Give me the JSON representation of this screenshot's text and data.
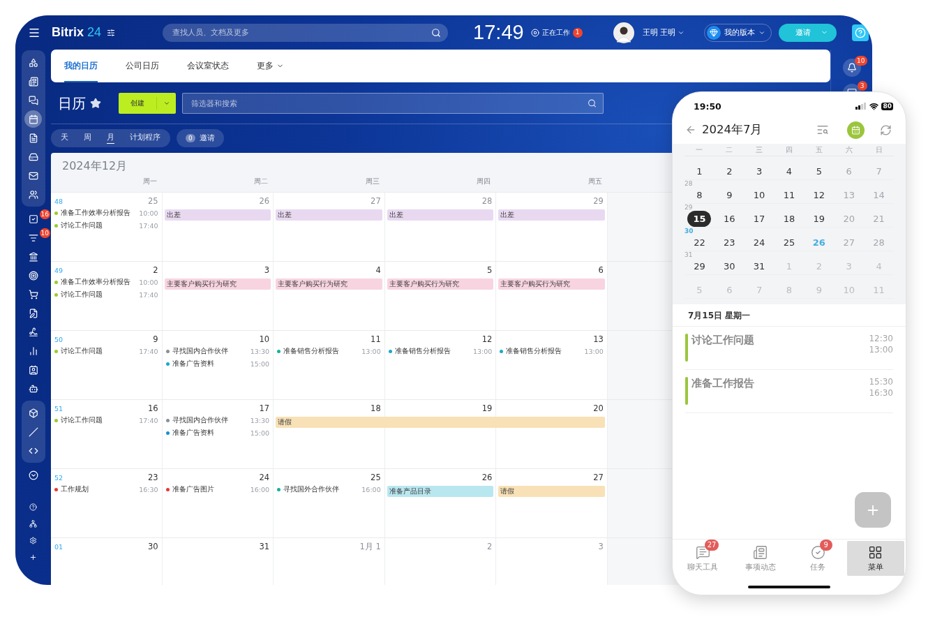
{
  "topbar": {
    "logo_name": "Bitrix",
    "logo_number": "24",
    "search": {
      "placeholder": "查找人员、文档及更多"
    },
    "clock": "17:49",
    "work_status": {
      "label": "正在工作",
      "badge": "1"
    },
    "user": {
      "name": "王明 王明"
    },
    "plan": {
      "label": "我的版本"
    },
    "invite_button": {
      "label": "邀请"
    }
  },
  "sidebar": {
    "sections": [
      {
        "kind": "group",
        "items": [
          {
            "selected": false
          },
          {
            "selected": false
          },
          {
            "selected": false
          },
          {
            "selected": true
          },
          {
            "selected": false
          },
          {
            "selected": false
          },
          {
            "selected": false
          },
          {
            "selected": false
          }
        ]
      },
      {
        "kind": "plain",
        "items": [
          {
            "selected": false,
            "badge": "16"
          },
          {
            "selected": false,
            "badge": "10"
          },
          {
            "selected": false
          },
          {
            "selected": false
          },
          {
            "selected": false
          },
          {
            "selected": false
          },
          {
            "selected": false
          },
          {
            "selected": false
          },
          {
            "selected": false
          },
          {
            "selected": false
          }
        ]
      },
      {
        "kind": "group",
        "items": [
          {
            "selected": false
          },
          {
            "selected": false
          },
          {
            "selected": false
          }
        ]
      },
      {
        "kind": "plain",
        "items": [
          {
            "selected": false
          }
        ]
      },
      {
        "kind": "tools",
        "items": [
          {
            "selected": false
          },
          {
            "selected": false
          },
          {
            "selected": false
          },
          {
            "selected": false
          }
        ]
      }
    ]
  },
  "right_rail": {
    "items": [
      {
        "kind": "help"
      },
      {
        "kind": "notify",
        "badge": "10"
      },
      {
        "kind": "notify",
        "badge": "3"
      }
    ]
  },
  "tabs": [
    {
      "label": "我的日历",
      "selected": true,
      "kind": "tab"
    },
    {
      "label": "公司日历",
      "selected": false,
      "kind": "tab"
    },
    {
      "label": "会议室状态",
      "selected": false,
      "kind": "tab"
    },
    {
      "label": "更多",
      "selected": false,
      "kind": "menu"
    }
  ],
  "toolbar": {
    "title": "日历",
    "create_button": "创建",
    "filter": {
      "placeholder": "筛选器和搜索"
    }
  },
  "views": [
    {
      "label": "天",
      "selected": false
    },
    {
      "label": "周",
      "selected": false
    },
    {
      "label": "月",
      "selected": true
    },
    {
      "label": "计划程序",
      "selected": false
    }
  ],
  "invitations": {
    "count": "0",
    "label": "邀请"
  },
  "calendar": {
    "month": "2024年12月",
    "weekdays": [
      "周一",
      "周二",
      "周三",
      "周四",
      "周五"
    ],
    "weeks": [
      {
        "week": "48",
        "days": [
          {
            "date": "25",
            "muted": true,
            "events": [
              {
                "kind": "dot",
                "title": "准备工作效率分析报告",
                "time": "10:00",
                "color": "#9ccc2c"
              },
              {
                "kind": "dot",
                "title": "讨论工作问题",
                "time": "17:40",
                "color": "#9ccc2c"
              }
            ]
          },
          {
            "date": "26",
            "muted": true,
            "events": [
              {
                "kind": "bar",
                "title": "出差",
                "color": "#e8d9f1"
              }
            ]
          },
          {
            "date": "27",
            "muted": true,
            "events": [
              {
                "kind": "bar",
                "title": "出差",
                "color": "#e8d9f1"
              }
            ]
          },
          {
            "date": "28",
            "muted": true,
            "events": [
              {
                "kind": "bar",
                "title": "出差",
                "color": "#e8d9f1"
              }
            ]
          },
          {
            "date": "29",
            "muted": true,
            "events": [
              {
                "kind": "bar",
                "title": "出差",
                "color": "#e8d9f1"
              }
            ]
          }
        ]
      },
      {
        "week": "49",
        "days": [
          {
            "date": "2",
            "muted": false,
            "events": [
              {
                "kind": "dot",
                "title": "准备工作效率分析报告",
                "time": "10:00",
                "color": "#9ccc2c"
              },
              {
                "kind": "dot",
                "title": "讨论工作问题",
                "time": "17:40",
                "color": "#9ccc2c"
              }
            ]
          },
          {
            "date": "3",
            "muted": false,
            "events": [
              {
                "kind": "bar",
                "title": "主要客户购买行为研究",
                "color": "#f8d4e0"
              }
            ]
          },
          {
            "date": "4",
            "muted": false,
            "events": [
              {
                "kind": "bar",
                "title": "主要客户购买行为研究",
                "color": "#f8d4e0"
              }
            ]
          },
          {
            "date": "5",
            "muted": false,
            "events": [
              {
                "kind": "bar",
                "title": "主要客户购买行为研究",
                "color": "#f8d4e0"
              }
            ]
          },
          {
            "date": "6",
            "muted": false,
            "events": [
              {
                "kind": "bar",
                "title": "主要客户购买行为研究",
                "color": "#f8d4e0"
              }
            ]
          }
        ]
      },
      {
        "week": "50",
        "days": [
          {
            "date": "9",
            "muted": false,
            "events": [
              {
                "kind": "dot",
                "title": "讨论工作问题",
                "time": "17:40",
                "color": "#9ccc2c"
              }
            ]
          },
          {
            "date": "10",
            "muted": false,
            "events": [
              {
                "kind": "dot",
                "title": "寻找国内合作伙伴",
                "time": "13:30",
                "color": "#8a8f98"
              },
              {
                "kind": "dot",
                "title": "准备广告资料",
                "time": "15:00",
                "color": "#1aa9c8"
              }
            ]
          },
          {
            "date": "11",
            "muted": false,
            "events": [
              {
                "kind": "dot",
                "title": "准备销售分析报告",
                "time": "13:00",
                "color": "#14b39c"
              }
            ]
          },
          {
            "date": "12",
            "muted": false,
            "events": [
              {
                "kind": "dot",
                "title": "准备销售分析报告",
                "time": "13:00",
                "color": "#1aa9c8"
              }
            ]
          },
          {
            "date": "13",
            "muted": false,
            "events": [
              {
                "kind": "dot",
                "title": "准备销售分析报告",
                "time": "13:00",
                "color": "#1aa9c8"
              }
            ]
          }
        ]
      },
      {
        "week": "51",
        "days": [
          {
            "date": "16",
            "muted": false,
            "events": [
              {
                "kind": "dot",
                "title": "讨论工作问题",
                "time": "17:40",
                "color": "#9ccc2c"
              }
            ]
          },
          {
            "date": "17",
            "muted": false,
            "events": [
              {
                "kind": "dot",
                "title": "寻找国内合作伙伴",
                "time": "13:30",
                "color": "#8a8f98"
              },
              {
                "kind": "dot",
                "title": "准备广告资料",
                "time": "15:00",
                "color": "#1a8fd0"
              }
            ]
          },
          {
            "date": "18",
            "muted": false,
            "events": [
              {
                "kind": "bar",
                "title": "请假",
                "color": "#f8e1b6"
              }
            ]
          },
          {
            "date": "19",
            "muted": false,
            "events": [
              {
                "kind": "continuation"
              }
            ]
          },
          {
            "date": "20",
            "muted": false,
            "events": [
              {
                "kind": "continuation"
              }
            ]
          }
        ]
      },
      {
        "week": "52",
        "days": [
          {
            "date": "23",
            "muted": false,
            "events": [
              {
                "kind": "dot",
                "title": "工作规划",
                "time": "16:30",
                "color": "#e53935"
              }
            ]
          },
          {
            "date": "24",
            "muted": false,
            "events": [
              {
                "kind": "dot",
                "title": "准备广告图片",
                "time": "16:00",
                "color": "#e53935"
              }
            ]
          },
          {
            "date": "25",
            "muted": false,
            "events": [
              {
                "kind": "dot",
                "title": "寻找国外合作伙伴",
                "time": "16:00",
                "color": "#14b39c"
              }
            ]
          },
          {
            "date": "26",
            "muted": false,
            "events": [
              {
                "kind": "bar",
                "title": "准备产品目录",
                "color": "#b9e7f0"
              }
            ]
          },
          {
            "date": "27",
            "muted": false,
            "events": [
              {
                "kind": "bar",
                "title": "请假",
                "color": "#f8e1b6"
              }
            ]
          }
        ]
      },
      {
        "week": "01",
        "days": [
          {
            "date": "30",
            "muted": false
          },
          {
            "date": "31",
            "muted": false
          },
          {
            "date": "1月 1",
            "muted": true
          },
          {
            "date": "2",
            "muted": true
          },
          {
            "date": "3",
            "muted": true
          }
        ]
      }
    ]
  },
  "phone": {
    "status_time": "19:50",
    "battery": "80",
    "title": "2024年7月",
    "weekdays": [
      "一",
      "二",
      "三",
      "四",
      "五",
      "六",
      "日"
    ],
    "weeks": [
      {
        "days": [
          {
            "label": "1",
            "kind": "weekday",
            "selected": false,
            "today": false
          },
          {
            "label": "2",
            "kind": "weekday",
            "selected": false,
            "today": false
          },
          {
            "label": "3",
            "kind": "weekday",
            "selected": false,
            "today": false
          },
          {
            "label": "4",
            "kind": "weekday",
            "selected": false,
            "today": false
          },
          {
            "label": "5",
            "kind": "weekday",
            "selected": false,
            "today": false
          },
          {
            "label": "6",
            "kind": "weekend",
            "selected": false,
            "today": false
          },
          {
            "label": "7",
            "kind": "weekend",
            "selected": false,
            "today": false
          }
        ]
      },
      {
        "week": "28",
        "current": false,
        "days": [
          {
            "label": "8",
            "kind": "weekday",
            "selected": false,
            "today": false
          },
          {
            "label": "9",
            "kind": "weekday",
            "selected": false,
            "today": false
          },
          {
            "label": "10",
            "kind": "weekday",
            "selected": false,
            "today": false
          },
          {
            "label": "11",
            "kind": "weekday",
            "selected": false,
            "today": false
          },
          {
            "label": "12",
            "kind": "weekday",
            "selected": false,
            "today": false
          },
          {
            "label": "13",
            "kind": "weekend",
            "selected": false,
            "today": false
          },
          {
            "label": "14",
            "kind": "weekend",
            "selected": false,
            "today": false
          }
        ]
      },
      {
        "week": "29",
        "current": false,
        "days": [
          {
            "label": "15",
            "kind": "weekday",
            "selected": true,
            "today": false
          },
          {
            "label": "16",
            "kind": "weekday",
            "selected": false,
            "today": false
          },
          {
            "label": "17",
            "kind": "weekday",
            "selected": false,
            "today": false
          },
          {
            "label": "18",
            "kind": "weekday",
            "selected": false,
            "today": false
          },
          {
            "label": "19",
            "kind": "weekday",
            "selected": false,
            "today": false
          },
          {
            "label": "20",
            "kind": "weekend",
            "selected": false,
            "today": false
          },
          {
            "label": "21",
            "kind": "weekend",
            "selected": false,
            "today": false
          }
        ]
      },
      {
        "week": "30",
        "current": true,
        "days": [
          {
            "label": "22",
            "kind": "weekday",
            "selected": false,
            "today": false
          },
          {
            "label": "23",
            "kind": "weekday",
            "selected": false,
            "today": false
          },
          {
            "label": "24",
            "kind": "weekday",
            "selected": false,
            "today": false
          },
          {
            "label": "25",
            "kind": "weekday",
            "selected": false,
            "today": false
          },
          {
            "label": "26",
            "kind": "weekday",
            "selected": false,
            "today": true
          },
          {
            "label": "27",
            "kind": "weekend",
            "selected": false,
            "today": false
          },
          {
            "label": "28",
            "kind": "weekend",
            "selected": false,
            "today": false
          }
        ]
      },
      {
        "week": "31",
        "current": false,
        "days": [
          {
            "label": "29",
            "kind": "weekday",
            "selected": false,
            "today": false
          },
          {
            "label": "30",
            "kind": "weekday",
            "selected": false,
            "today": false
          },
          {
            "label": "31",
            "kind": "weekday",
            "selected": false,
            "today": false
          },
          {
            "label": "1",
            "kind": "outside",
            "selected": false,
            "today": false
          },
          {
            "label": "2",
            "kind": "outside",
            "selected": false,
            "today": false
          },
          {
            "label": "3",
            "kind": "outside",
            "selected": false,
            "today": false
          },
          {
            "label": "4",
            "kind": "outside",
            "selected": false,
            "today": false
          }
        ]
      },
      {
        "days": [
          {
            "label": "5",
            "kind": "outside",
            "selected": false,
            "today": false
          },
          {
            "label": "6",
            "kind": "outside",
            "selected": false,
            "today": false
          },
          {
            "label": "7",
            "kind": "outside",
            "selected": false,
            "today": false
          },
          {
            "label": "8",
            "kind": "outside",
            "selected": false,
            "today": false
          },
          {
            "label": "9",
            "kind": "outside",
            "selected": false,
            "today": false
          },
          {
            "label": "10",
            "kind": "outside",
            "selected": false,
            "today": false
          },
          {
            "label": "11",
            "kind": "outside",
            "selected": false,
            "today": false
          }
        ]
      }
    ],
    "agenda_date": "7月15日 星期一",
    "events": [
      {
        "title": "讨论工作问题",
        "start": "12:30",
        "end": "13:00"
      },
      {
        "title": "准备工作报告",
        "start": "15:30",
        "end": "16:30"
      }
    ],
    "tabbar": [
      {
        "label": "聊天工具",
        "badge": "27",
        "selected": false
      },
      {
        "label": "事项动态",
        "selected": false
      },
      {
        "label": "任务",
        "badge": "9",
        "selected": false
      },
      {
        "label": "菜单",
        "selected": true
      }
    ]
  }
}
